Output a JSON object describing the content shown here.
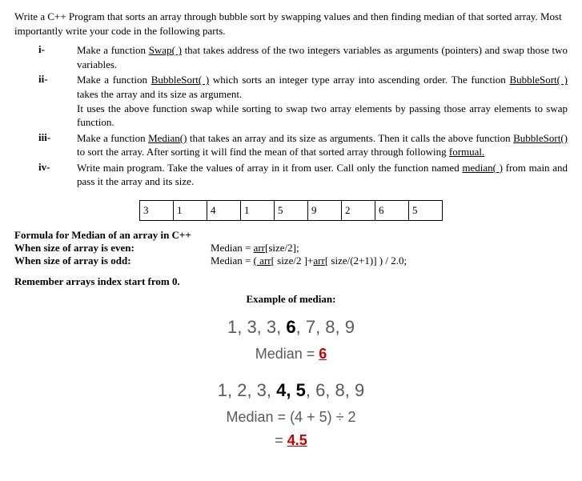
{
  "intro": "Write a C++ Program that sorts an array through bubble sort by swapping values and then finding median of that sorted array. Most importantly write your code in the following parts.",
  "items": {
    "i": {
      "num": "i-",
      "pre": "Make a function ",
      "fn": "Swap( )",
      "post": " that takes address of the two integers variables as arguments (pointers) and swap those two variables."
    },
    "ii": {
      "num": "ii-",
      "pre1": "Make a function ",
      "fn1": "BubbleSort( )",
      "mid1": " which sorts an integer type array into ascending order. The function ",
      "fn1b": "BubbleSort( )",
      "post1": " takes the array and its size as argument.",
      "line2": "It uses the above function swap while sorting to swap two array elements by passing those array elements to swap function."
    },
    "iii": {
      "num": "iii-",
      "pre": "Make a function ",
      "fn": "Median()",
      "mid": " that takes an array and its size as arguments. Then it calls the above function ",
      "fn2": "BubbleSort()",
      "post": " to sort the array. After sorting it will find the mean of that sorted array through following ",
      "formual": "formual."
    },
    "iv": {
      "num": "iv-",
      "pre": "Write main program. Take the values of array in it from user. Call only the function named ",
      "fn": "median( )",
      "post": " from main and pass it the array and its size."
    }
  },
  "array_cells": [
    "3",
    "1",
    "4",
    "1",
    "5",
    "9",
    "2",
    "6",
    "5"
  ],
  "formula": {
    "heading": "Formula for Median of an array in C++",
    "even_label": "When size of array is even:",
    "even_expr_pre": "Median = ",
    "even_expr_arr": "arr",
    "even_expr_post": "[size/2];",
    "odd_label": "When size of array is odd:",
    "odd_expr_pre": "Median = ",
    "odd_open": "(",
    "odd_arr1": " arr",
    "odd_mid1": "[ size/2 ]+",
    "odd_arr2": "arr",
    "odd_mid2": "[ size/(2+1)] ) / 2.0;"
  },
  "remember": "Remember arrays index start from 0.",
  "example_heading": "Example of median:",
  "ex1": {
    "seq_a": "1, 3, 3, ",
    "seq_bold": "6",
    "seq_b": ", 7, 8, 9",
    "median_label": "Median  =  ",
    "median_val": "6"
  },
  "ex2": {
    "seq_a": "1, 2, 3, ",
    "seq_bold": "4, 5",
    "seq_b": ", 6, 8, 9",
    "median_label": "Median  =  ",
    "median_expr": "(4 + 5) ÷ 2",
    "eq2_label": "=  ",
    "median_val": "4.5"
  }
}
